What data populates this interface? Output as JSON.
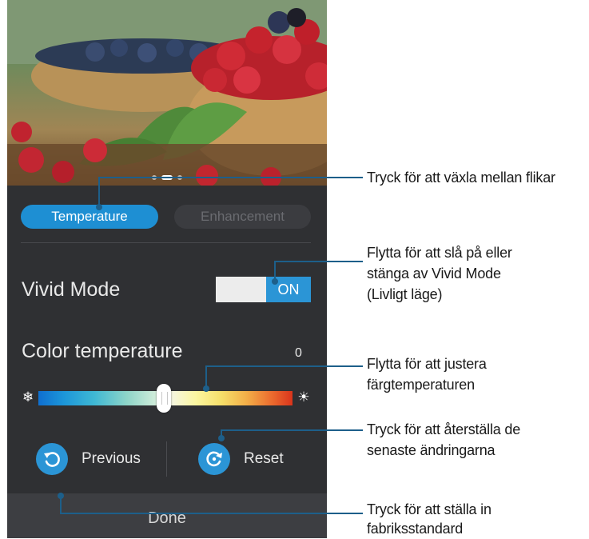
{
  "tabs": {
    "temperature": "Temperature",
    "enhancement": "Enhancement"
  },
  "vivid_mode": {
    "label": "Vivid Mode",
    "toggle_state": "ON"
  },
  "color_temperature": {
    "label": "Color temperature",
    "value": "0"
  },
  "actions": {
    "previous": "Previous",
    "reset": "Reset",
    "done": "Done"
  },
  "callouts": {
    "tabs": "Tryck för att växla mellan flikar",
    "vivid_line1": "Flytta för att slå på eller",
    "vivid_line2": "stänga av Vivid Mode",
    "vivid_line3": "(Livligt läge)",
    "slider_line1": "Flytta för att justera",
    "slider_line2": "färgtemperaturen",
    "reset_line1": "Tryck för att återställa de",
    "reset_line2": "senaste ändringarna",
    "done_line1": "Tryck för att ställa in",
    "done_line2": "fabriksstandard"
  },
  "colors": {
    "accent": "#1e8fd3",
    "background": "#2f3033",
    "callout_line": "#1d5f8a"
  },
  "icons": {
    "cold": "snowflake-icon",
    "warm": "sun-icon",
    "previous": "undo-icon",
    "reset": "reset-icon"
  }
}
